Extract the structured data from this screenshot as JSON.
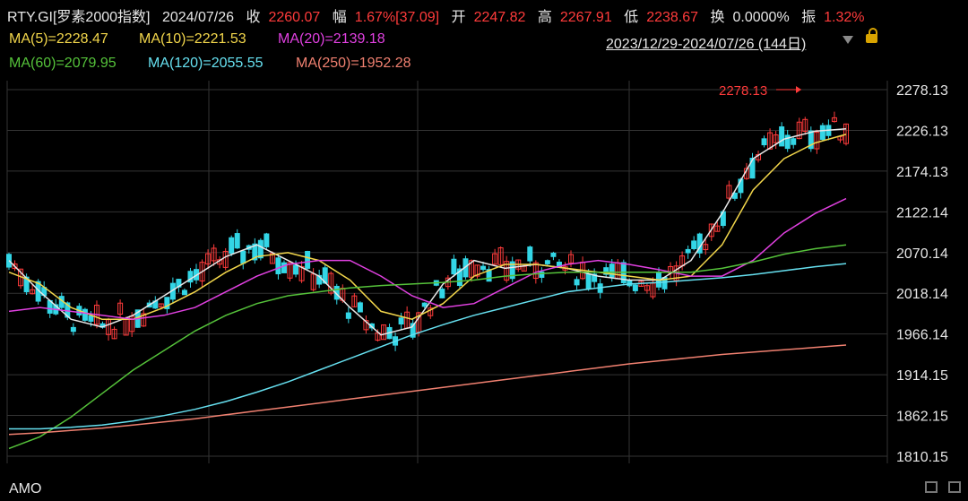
{
  "header": {
    "symbol": "RTY.GI[罗素2000指数]",
    "date": "2024/07/26",
    "close_label": "收",
    "close_value": "2260.07",
    "change_label": "幅",
    "change_value": "1.67%[37.09]",
    "open_label": "开",
    "open_value": "2247.82",
    "high_label": "高",
    "high_value": "2267.91",
    "low_label": "低",
    "low_value": "2238.67",
    "turnover_label": "换",
    "turnover_value": "0.0000%",
    "amplitude_label": "振",
    "amplitude_value": "1.32%"
  },
  "ma_legend": {
    "ma5": "MA(5)=2228.47",
    "ma10": "MA(10)=2221.53",
    "ma20": "MA(20)=2139.18",
    "ma60": "MA(60)=2079.95",
    "ma120": "MA(120)=2055.55",
    "ma250": "MA(250)=1952.28"
  },
  "range_label": "2023/12/29-2024/07/26 (144日)",
  "footer": {
    "indicator": "AMO"
  },
  "colors": {
    "up": "#ff3b3b",
    "down": "#33d6e6",
    "ma5": "#e8e8e8",
    "ma10": "#f2d64b",
    "ma20": "#e040e0",
    "ma60": "#55c23a",
    "ma120": "#66e0f0",
    "ma250": "#f08070"
  },
  "chart_data": {
    "type": "candlestick",
    "y_ticks": [
      "2278.13",
      "2226.13",
      "2174.13",
      "2122.14",
      "2070.14",
      "2018.14",
      "1966.14",
      "1914.15",
      "1862.15",
      "1810.15"
    ],
    "ylim": [
      1810.15,
      2278.13
    ],
    "max_annotation": "2278.13",
    "series": [
      {
        "name": "MA(5)",
        "values": [
          2060,
          2020,
          1985,
          1975,
          1990,
          2015,
          2040,
          2065,
          2080,
          2060,
          2040,
          2000,
          1965,
          1975,
          2030,
          2060,
          2050,
          2055,
          2050,
          2040,
          2035,
          2035,
          2060,
          2120,
          2190,
          2215,
          2225,
          2228
        ]
      },
      {
        "name": "MA(10)",
        "values": [
          2045,
          2030,
          2000,
          1985,
          1985,
          2000,
          2020,
          2045,
          2065,
          2070,
          2060,
          2035,
          1995,
          1985,
          2005,
          2040,
          2055,
          2055,
          2050,
          2045,
          2040,
          2035,
          2040,
          2080,
          2150,
          2190,
          2210,
          2221
        ]
      },
      {
        "name": "MA(20)",
        "values": [
          1995,
          2000,
          1995,
          1990,
          1985,
          1990,
          2000,
          2020,
          2040,
          2055,
          2060,
          2060,
          2040,
          2015,
          2000,
          2005,
          2025,
          2045,
          2055,
          2060,
          2055,
          2048,
          2040,
          2040,
          2060,
          2095,
          2120,
          2139
        ]
      },
      {
        "name": "MA(60)",
        "values": [
          1820,
          1835,
          1860,
          1890,
          1920,
          1945,
          1970,
          1990,
          2005,
          2015,
          2020,
          2025,
          2028,
          2030,
          2032,
          2035,
          2040,
          2043,
          2045,
          2045,
          2045,
          2045,
          2045,
          2050,
          2058,
          2068,
          2075,
          2080
        ]
      },
      {
        "name": "MA(120)",
        "values": [
          1845,
          1845,
          1847,
          1850,
          1855,
          1862,
          1870,
          1880,
          1892,
          1905,
          1920,
          1935,
          1950,
          1965,
          1978,
          1990,
          2000,
          2010,
          2020,
          2025,
          2030,
          2032,
          2035,
          2038,
          2042,
          2047,
          2052,
          2056
        ]
      },
      {
        "name": "MA(250)",
        "values": [
          1838,
          1840,
          1843,
          1846,
          1850,
          1854,
          1858,
          1863,
          1868,
          1873,
          1878,
          1883,
          1888,
          1893,
          1898,
          1903,
          1908,
          1913,
          1918,
          1923,
          1928,
          1932,
          1936,
          1940,
          1943,
          1946,
          1949,
          1952
        ]
      }
    ]
  }
}
